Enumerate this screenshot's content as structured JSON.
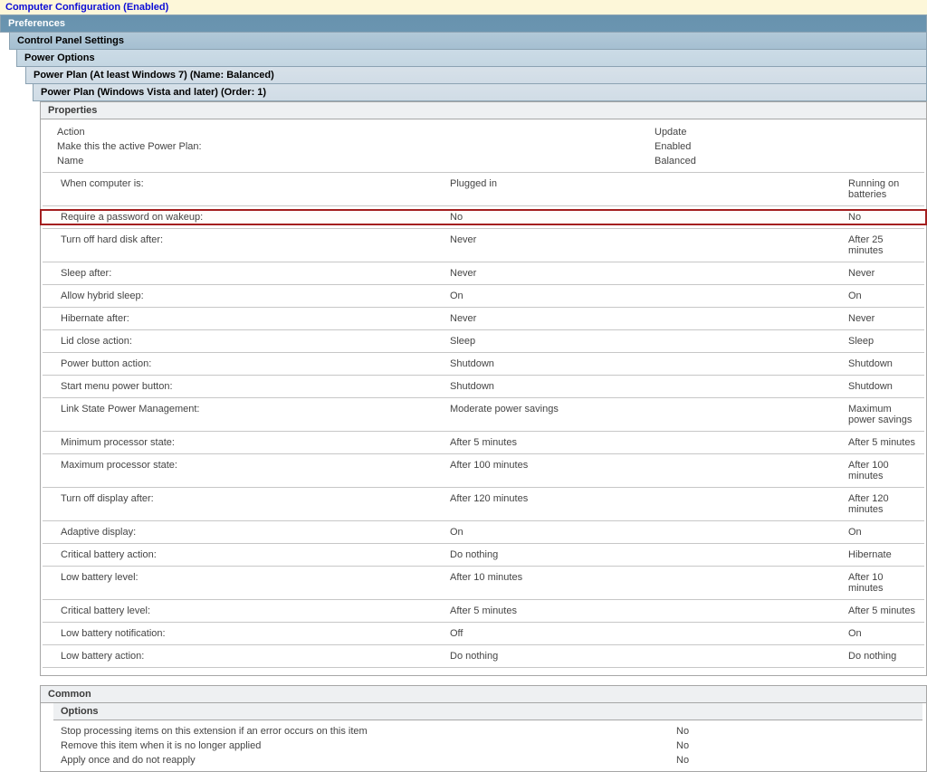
{
  "top_title": "Computer Configuration (Enabled)",
  "headers": {
    "preferences": "Preferences",
    "control_panel": "Control Panel Settings",
    "power_options": "Power Options",
    "plan_a": "Power Plan (At least Windows 7) (Name: Balanced)",
    "plan_b": "Power Plan (Windows Vista and later) (Order: 1)"
  },
  "properties_title": "Properties",
  "summary": [
    {
      "k": "Action",
      "v": "Update"
    },
    {
      "k": "Make this the active Power Plan:",
      "v": "Enabled"
    },
    {
      "k": "Name",
      "v": "Balanced"
    }
  ],
  "cols": {
    "c1": "When computer is:",
    "c2": "Plugged in",
    "c3": "Running on batteries"
  },
  "settings": [
    {
      "k": "Require a password on wakeup:",
      "p": "No",
      "b": "No",
      "hl": true
    },
    {
      "k": "Turn off hard disk after:",
      "p": "Never",
      "b": "After 25 minutes"
    },
    {
      "k": "Sleep after:",
      "p": "Never",
      "b": "Never"
    },
    {
      "k": "Allow hybrid sleep:",
      "p": "On",
      "b": "On"
    },
    {
      "k": "Hibernate after:",
      "p": "Never",
      "b": "Never"
    },
    {
      "k": "Lid close action:",
      "p": "Sleep",
      "b": "Sleep"
    },
    {
      "k": "Power button action:",
      "p": "Shutdown",
      "b": "Shutdown"
    },
    {
      "k": "Start menu power button:",
      "p": "Shutdown",
      "b": "Shutdown"
    },
    {
      "k": "Link State Power Management:",
      "p": "Moderate power savings",
      "b": "Maximum power savings"
    },
    {
      "k": "Minimum processor state:",
      "p": "After 5 minutes",
      "b": "After 5 minutes"
    },
    {
      "k": "Maximum processor state:",
      "p": "After 100 minutes",
      "b": "After 100 minutes"
    },
    {
      "k": "Turn off display after:",
      "p": "After 120 minutes",
      "b": "After 120 minutes"
    },
    {
      "k": "Adaptive display:",
      "p": "On",
      "b": "On"
    },
    {
      "k": "Critical battery action:",
      "p": "Do nothing",
      "b": "Hibernate"
    },
    {
      "k": "Low battery level:",
      "p": "After 10 minutes",
      "b": "After 10 minutes"
    },
    {
      "k": "Critical battery level:",
      "p": "After 5 minutes",
      "b": "After 5 minutes"
    },
    {
      "k": "Low battery notification:",
      "p": "Off",
      "b": "On"
    },
    {
      "k": "Low battery action:",
      "p": "Do nothing",
      "b": "Do nothing"
    }
  ],
  "common_title": "Common",
  "options_title": "Options",
  "options": [
    {
      "k": "Stop processing items on this extension if an error occurs on this item",
      "v": "No"
    },
    {
      "k": "Remove this item when it is no longer applied",
      "v": "No"
    },
    {
      "k": "Apply once and do not reapply",
      "v": "No"
    }
  ]
}
